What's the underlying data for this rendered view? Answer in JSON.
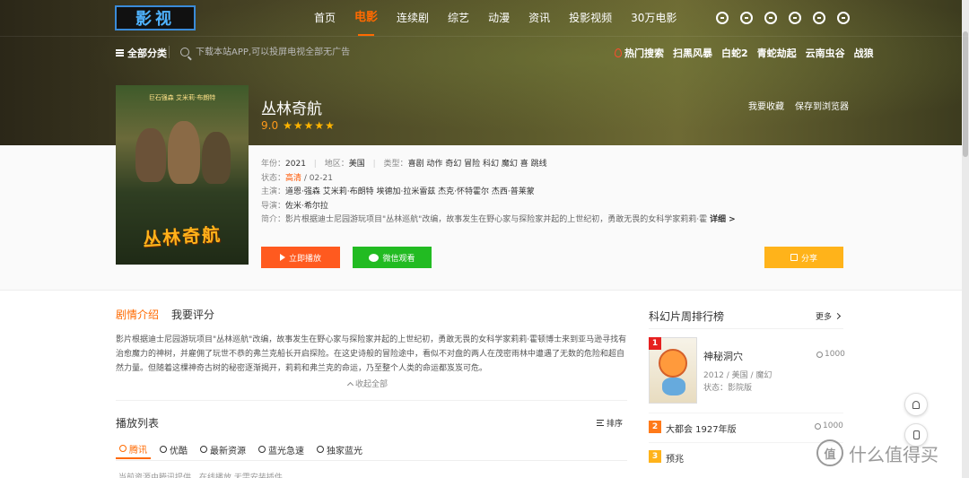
{
  "app": {
    "logo_text": "影视"
  },
  "nav": {
    "links": [
      "首页",
      "电影",
      "连续剧",
      "综艺",
      "动漫",
      "资讯",
      "投影视频",
      "30万电影"
    ],
    "active_index": 1,
    "icons": [
      "history-icon",
      "message-icon",
      "gift-icon",
      "box-icon",
      "download-icon",
      "user-icon"
    ]
  },
  "subbar": {
    "categories_label": "全部分类",
    "search_placeholder": "下载本站APP,可以投屏电视全部无广告",
    "hot_label": "热门搜索",
    "hot_items": [
      "扫黑风暴",
      "白蛇2",
      "青蛇劫起",
      "云南虫谷",
      "战狼"
    ]
  },
  "movie": {
    "title": "丛林奇航",
    "score": "9.0",
    "stars": 5,
    "actions": [
      "我要收藏",
      "保存到浏览器"
    ],
    "poster_title": "丛林奇航",
    "poster_top": "巨石强森  艾米莉·布朗特",
    "info": {
      "year_label": "年份：",
      "year": "2021",
      "region_label": "地区：",
      "region": "美国",
      "type_label": "类型：",
      "types": "喜剧 动作 奇幻 冒险 科幻 魔幻 喜 跳线",
      "status_label": "状态：",
      "status_hd": "高清",
      "status_date": "/ 02-21",
      "cast_label": "主演：",
      "cast": "道恩·强森 艾米莉·布朗特 埃德加·拉米雷兹 杰克·怀特霍尔 杰西·普莱蒙",
      "director_label": "导演：",
      "director": "佐米·希尔拉",
      "intro_label": "简介：",
      "intro": "影片根据迪士尼园游玩项目\"丛林巡航\"改编，故事发生在野心家与探险家并起的上世纪初，勇敢无畏的女科学家莉莉·霍",
      "more": "详细 >"
    },
    "buttons": {
      "play": "立即播放",
      "wechat": "微信观看",
      "share": "分享"
    }
  },
  "tabs": [
    "剧情介绍",
    "我要评分"
  ],
  "synopsis": "影片根据迪士尼园游玩项目\"丛林巡航\"改编，故事发生在野心家与探险家并起的上世纪初，勇敢无畏的女科学家莉莉·霍顿博士来到亚马逊寻找有治愈魔力的神树，并雇佣了玩世不恭的弗兰克船长开启探险。在这史诗般的冒险途中，看似不对盘的两人在茂密雨林中遭遇了无数的危险和超自然力量。但随着这棵神奇古树的秘密逐渐揭开，莉莉和弗兰克的命运，乃至整个人类的命运都岌岌可危。",
  "collapse_label": "收起全部",
  "playlist": {
    "title": "播放列表",
    "sort_label": "排序",
    "sources": [
      "腾讯",
      "优酷",
      "最新资源",
      "蓝光急速",
      "独家蓝光"
    ],
    "active_index": 0,
    "notice": "当前资源由腾讯提供，在线播放 无需安装插件"
  },
  "ranking": {
    "title": "科幻片周排行榜",
    "more": "更多",
    "items": [
      {
        "rank": "1",
        "name": "神秘洞穴",
        "meta": "2012 / 美国 / 魔幻",
        "status": "状态：影院版",
        "heat": "1000"
      },
      {
        "rank": "2",
        "name": "大都会 1927年版",
        "heat": "1000"
      },
      {
        "rank": "3",
        "name": "预兆"
      }
    ]
  },
  "watermark": {
    "logo": "值",
    "text": "什么值得买"
  }
}
